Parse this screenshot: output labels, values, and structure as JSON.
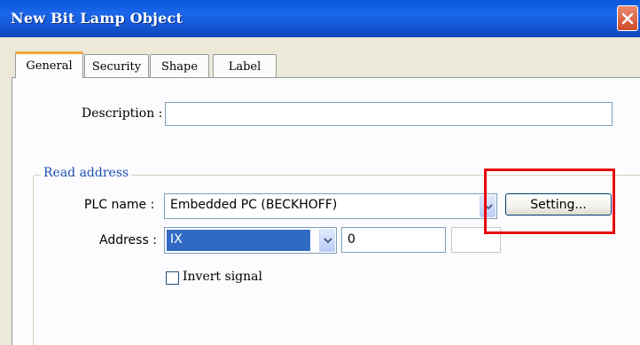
{
  "window": {
    "title": "New  Bit Lamp Object",
    "close_icon": "close-icon"
  },
  "tabs": [
    {
      "label": "General",
      "active": true
    },
    {
      "label": "Security",
      "active": false
    },
    {
      "label": "Shape",
      "active": false
    },
    {
      "label": "Label",
      "active": false
    }
  ],
  "general": {
    "description_label": "Description :",
    "description_value": "",
    "read_address": {
      "legend": "Read address",
      "plc_name_label": "PLC name :",
      "plc_name_value": "Embedded PC (BECKHOFF)",
      "setting_button": "Setting...",
      "address_label": "Address :",
      "address_type_value": "IX",
      "address_value": "0",
      "address_extra_value": ""
    },
    "invert_signal_label": "Invert signal",
    "invert_signal_checked": false
  },
  "colors": {
    "titlebar": "#1a67ec",
    "highlight_box": "#e8060a",
    "selection": "#316ac5"
  }
}
